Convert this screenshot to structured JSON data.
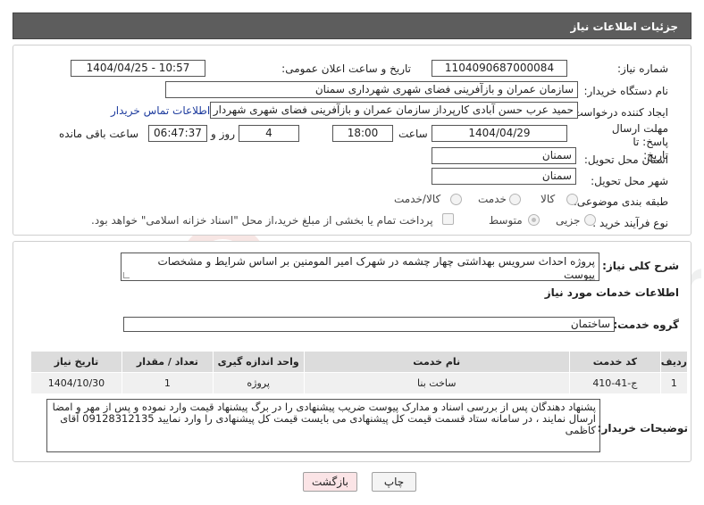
{
  "header": {
    "title": "جزئیات اطلاعات نیاز"
  },
  "need_info": {
    "need_number_label": "شماره نیاز:",
    "need_number": "1104090687000084",
    "announce_label": "تاریخ و ساعت اعلان عمومی:",
    "announce_value": "1404/04/25 - 10:57",
    "buyer_org_label": "نام دستگاه خریدار:",
    "buyer_org": "سازمان عمران و بازآفرینی فضای شهری شهرداری سمنان",
    "creator_label": "ایجاد کننده درخواست:",
    "creator": "حمید عرب حسن آبادی کارپرداز سازمان عمران و بازآفرینی فضای شهری شهردار",
    "contact_link": "اطلاعات تماس خریدار",
    "deadline_label": "مهلت ارسال پاسخ: تا تاریخ:",
    "deadline_date": "1404/04/29",
    "time_label": "ساعت",
    "deadline_time": "18:00",
    "days_value": "4",
    "days_label": "روز و",
    "remaining_time": "06:47:37",
    "remaining_label": "ساعت باقی مانده",
    "province_label": "استان محل تحویل:",
    "province": "سمنان",
    "city_label": "شهر محل تحویل:",
    "city": "سمنان",
    "category_label": "طبقه بندی موضوعی:",
    "category_options": [
      "کالا",
      "خدمت",
      "کالا/خدمت"
    ],
    "process_label": "نوع فرآیند خرید :",
    "process_options": [
      "جزیی",
      "متوسط"
    ],
    "payment_note": "پرداخت تمام یا بخشی از مبلغ خرید،از محل \"اسناد خزانه اسلامی\" خواهد بود."
  },
  "details": {
    "summary_label": "شرح کلی نیاز:",
    "summary": "پروژه احداث سرویس بهداشتی چهار چشمه در شهرک امیر المومنین بر اساس شرایط و مشخصات پیوست",
    "services_title": "اطلاعات خدمات مورد نیاز",
    "service_group_label": "گروه خدمت:",
    "service_group": "ساختمان",
    "table": {
      "headers": [
        "ردیف",
        "کد خدمت",
        "نام خدمت",
        "واحد اندازه گیری",
        "تعداد / مقدار",
        "تاریخ نیاز"
      ],
      "rows": [
        [
          "1",
          "ج-41-410",
          "ساخت بنا",
          "پروژه",
          "1",
          "1404/10/30"
        ]
      ]
    },
    "buyer_notes_label": "توضیحات خریدار:",
    "buyer_notes": "پشنهاد دهندگان پس از بررسی اسناد و مدارک پیوست ضریب پیشنهادی را در برگ پیشنهاد قیمت وارد نموده و پس از مهر و امضا ارسال نمایند ، در سامانه ستاد قسمت قیمت کل پیشنهادی می بایست قیمت کل پیشنهادی را وارد نمایید 09128312135 آقای کاظمی"
  },
  "buttons": {
    "print": "چاپ",
    "back": "بازگشت"
  },
  "watermark": "AriaTender.neT",
  "colors": {
    "header_bg": "#5d5d5d",
    "link": "#1e3c9e",
    "back_button_bg": "#fbe4e6"
  }
}
